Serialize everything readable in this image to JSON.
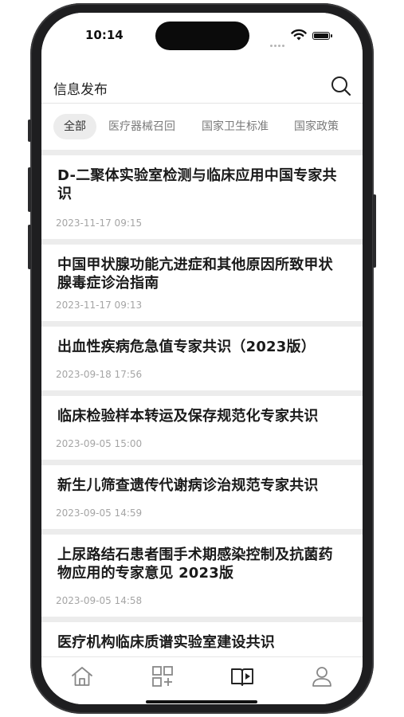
{
  "status": {
    "time": "10:14"
  },
  "header": {
    "title": "信息发布"
  },
  "tabs": [
    "全部",
    "医疗器械召回",
    "国家卫生标准",
    "国家政策"
  ],
  "articles": [
    {
      "title": "D-二聚体实验室检测与临床应用中国专家共识",
      "date": "2023-11-17 09:15"
    },
    {
      "title": "中国甲状腺功能亢进症和其他原因所致甲状腺毒症诊治指南",
      "date": "2023-11-17 09:13"
    },
    {
      "title": "出血性疾病危急值专家共识（2023版）",
      "date": "2023-09-18 17:56"
    },
    {
      "title": "临床检验样本转运及保存规范化专家共识",
      "date": "2023-09-05 15:00"
    },
    {
      "title": "新生儿筛查遗传代谢病诊治规范专家共识",
      "date": "2023-09-05 14:59"
    },
    {
      "title": "上尿路结石患者围手术期感染控制及抗菌药物应用的专家意见 2023版",
      "date": "2023-09-05 14:58"
    },
    {
      "title": "医疗机构临床质谱实验室建设共识",
      "date": ""
    }
  ],
  "nav": [
    "home-icon",
    "apps-add-icon",
    "reader-icon",
    "user-icon"
  ]
}
